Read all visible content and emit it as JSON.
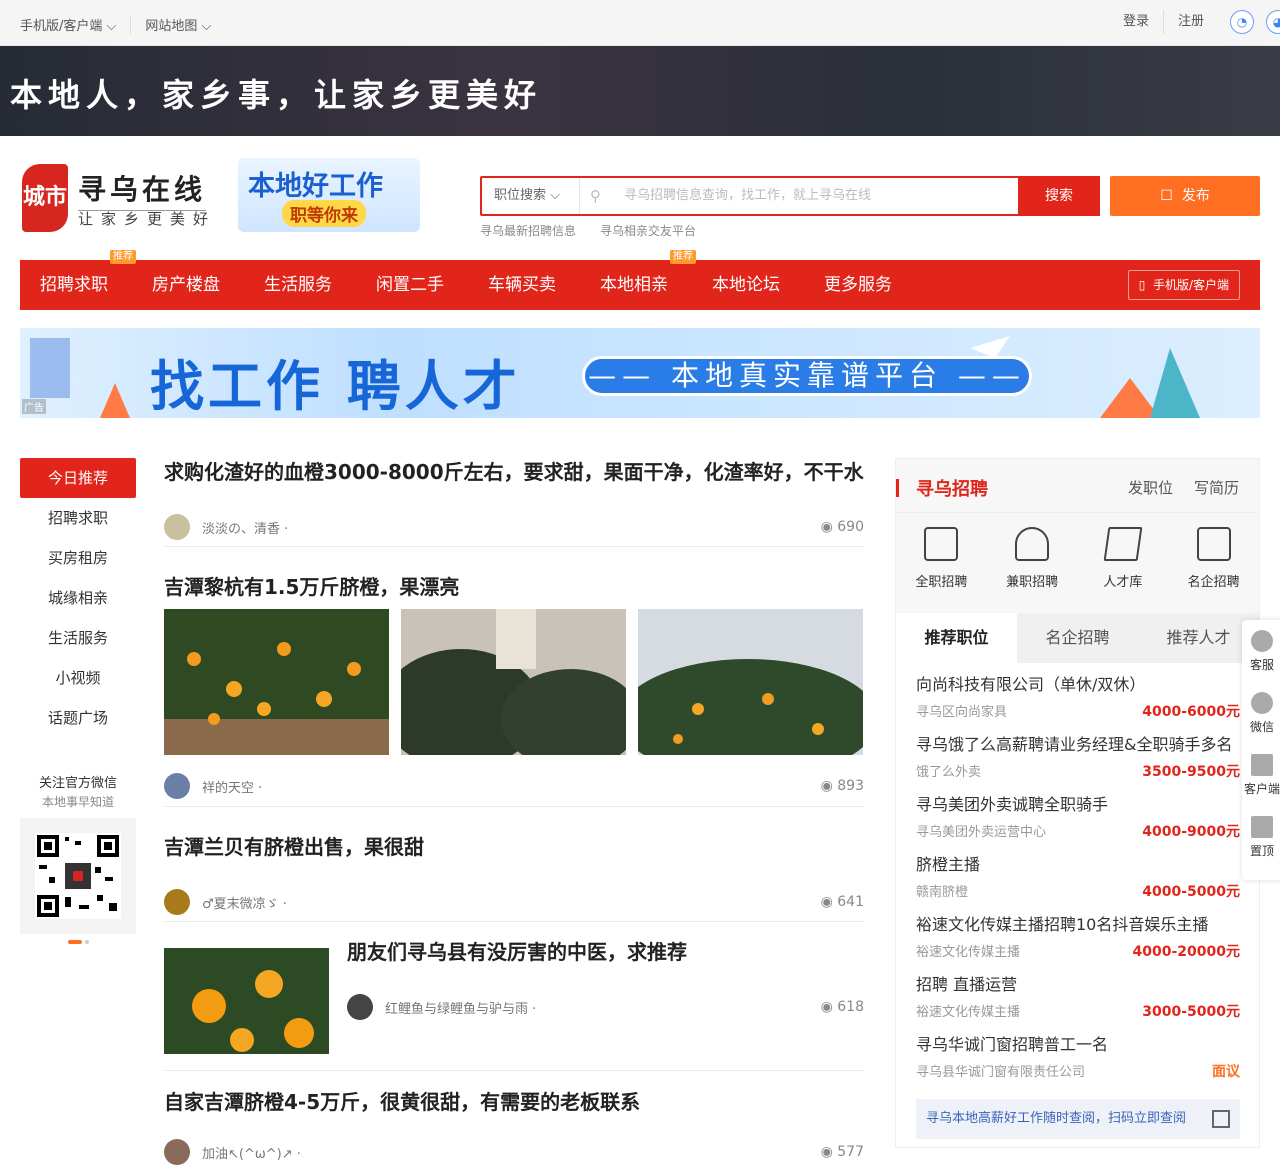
{
  "topbar": {
    "mobile_label": "手机版/客户端",
    "sitemap_label": "网站地图",
    "login": "登录",
    "register": "注册"
  },
  "banner": {
    "slogan": "本地人，家乡事，让家乡更美好"
  },
  "logo": {
    "seal": "城市",
    "name": "寻乌在线",
    "subtitle": "让家乡更美好"
  },
  "jobad": {
    "line1": "本地好工作",
    "line2": "职等你来"
  },
  "search": {
    "select_label": "职位搜索",
    "placeholder": "寻乌招聘信息查询，找工作，就上寻乌在线",
    "button": "搜索",
    "hotkeys": [
      "寻乌最新招聘信息",
      "寻乌相亲交友平台"
    ]
  },
  "publish_label": "发布",
  "nav": {
    "items": [
      "招聘求职",
      "房产楼盘",
      "生活服务",
      "闲置二手",
      "车辆买卖",
      "本地相亲",
      "本地论坛",
      "更多服务"
    ],
    "tag": "推荐",
    "mobile": "手机版/客户端"
  },
  "ad": {
    "headline": "找工作  聘人才",
    "pill": "—— 本地真实靠谱平台 ——",
    "tag": "广告"
  },
  "sidebar": {
    "items": [
      "今日推荐",
      "招聘求职",
      "买房租房",
      "城缘相亲",
      "生活服务",
      "小视频",
      "话题广场"
    ],
    "wechat_title": "关注官方微信",
    "wechat_sub": "本地事早知道"
  },
  "feed": [
    {
      "title": "求购化渣好的血橙3000-8000斤左右，要求甜，果面干净，化渣率好，不干水",
      "author": "淡淡の、清香 ·",
      "views": "690"
    },
    {
      "title": "吉潭黎杭有1.5万斤脐橙，果漂亮",
      "author": "祥的天空 ·",
      "views": "893"
    },
    {
      "title": "吉潭兰贝有脐橙出售，果很甜",
      "author": "♂夏末微凉ゞ ·",
      "views": "641"
    },
    {
      "title": "朋友们寻乌县有没厉害的中医，求推荐",
      "author": "红鲤鱼与绿鲤鱼与驴与雨 ·",
      "views": "618"
    },
    {
      "title": "自家吉潭脐橙4-5万斤，很黄很甜，有需要的老板联系",
      "author": "加油↖(^ω^)↗ ·",
      "views": "577"
    }
  ],
  "right": {
    "title": "寻乌招聘",
    "links": [
      "发职位",
      "写简历"
    ],
    "cats": [
      "全职招聘",
      "兼职招聘",
      "人才库",
      "名企招聘"
    ],
    "tabs": [
      "推荐职位",
      "名企招聘",
      "推荐人才"
    ],
    "jobs": [
      {
        "name": "向尚科技有限公司（单休/双休）",
        "company": "寻乌区向尚家具",
        "pay": "4000-6000元"
      },
      {
        "name": "寻乌饿了么高薪聘请业务经理&全职骑手多名",
        "company": "饿了么外卖",
        "pay": "3500-9500元"
      },
      {
        "name": "寻乌美团外卖诚聘全职骑手",
        "company": "寻乌美团外卖运营中心",
        "pay": "4000-9000元"
      },
      {
        "name": "脐橙主播",
        "company": "赣南脐橙",
        "pay": "4000-5000元"
      },
      {
        "name": "裕速文化传媒主播招聘10名抖音娱乐主播",
        "company": "裕速文化传媒主播",
        "pay": "4000-20000元"
      },
      {
        "name": "招聘 直播运营",
        "company": "裕速文化传媒主播",
        "pay": "3000-5000元"
      },
      {
        "name": "寻乌华诚门窗招聘普工一名",
        "company": "寻乌县华诚门窗有限责任公司",
        "pay": "面议"
      }
    ],
    "qr_text": "寻乌本地高薪好工作随时查阅，扫码立即查阅"
  },
  "float": [
    "客服",
    "微信",
    "客户端",
    "置顶"
  ],
  "colors": {
    "brand_red": "#e1251b",
    "orange": "#ff6f21"
  }
}
